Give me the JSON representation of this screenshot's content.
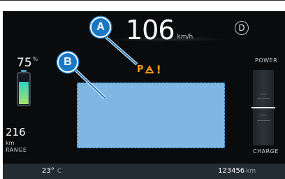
{
  "speed": {
    "value": "106",
    "unit": "km/h"
  },
  "gear": "D",
  "battery": {
    "percent": "75",
    "percent_unit": "%",
    "level": 0.75
  },
  "range": {
    "value": "216",
    "unit": "km",
    "label": "RANGE"
  },
  "power_meter": {
    "top_label": "POWER",
    "bottom_label": "CHARGE"
  },
  "warning": {
    "text": "P",
    "icon": "parking-sensor-warning-icon",
    "mark": "!"
  },
  "callouts": {
    "a": "A",
    "b": "B"
  },
  "status": {
    "temperature": "23°",
    "temperature_unit": "C",
    "odometer": "123456",
    "odometer_unit": "km"
  },
  "colors": {
    "accent": "#1a78c2",
    "warning": "#ff9f1c",
    "placeholder": "#7eb7e1"
  }
}
